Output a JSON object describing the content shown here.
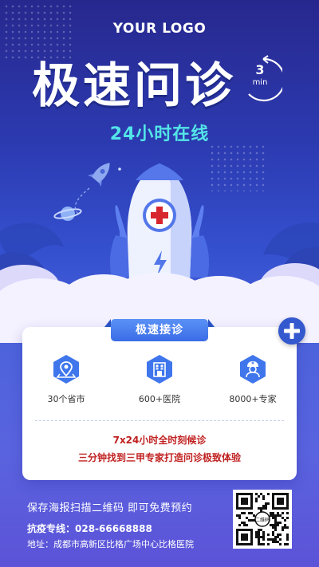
{
  "brand": {
    "logo_text": "YOUR LOGO"
  },
  "hero": {
    "headline": "极速问诊",
    "timer_number": "3",
    "timer_unit": "min",
    "subtitle": "24小时在线"
  },
  "card": {
    "tag": "极速接诊",
    "features": [
      {
        "icon": "map-pin-icon",
        "label": "30个省市"
      },
      {
        "icon": "hospital-building-icon",
        "label": "600+医院"
      },
      {
        "icon": "doctor-icon",
        "label": "8000+专家"
      }
    ],
    "note_line_1": "7x24小时全时刻候诊",
    "note_line_2": "三分钟找到三甲专家打造问诊极致体验"
  },
  "footer": {
    "scan_text": "保存海报扫描二维码 即可免费预约",
    "hotline": "抗疫专线：028-66668888",
    "address": "地址：成都市高新区比格广场中心比格医院",
    "qr_label": "二维码"
  },
  "colors": {
    "background_top": "#27288e",
    "background_bottom": "#5c53d8",
    "accent_cyan": "#53e5e8",
    "accent_blue": "#3a6ce6",
    "note_red": "#c02020",
    "cross_red": "#d8262e"
  }
}
